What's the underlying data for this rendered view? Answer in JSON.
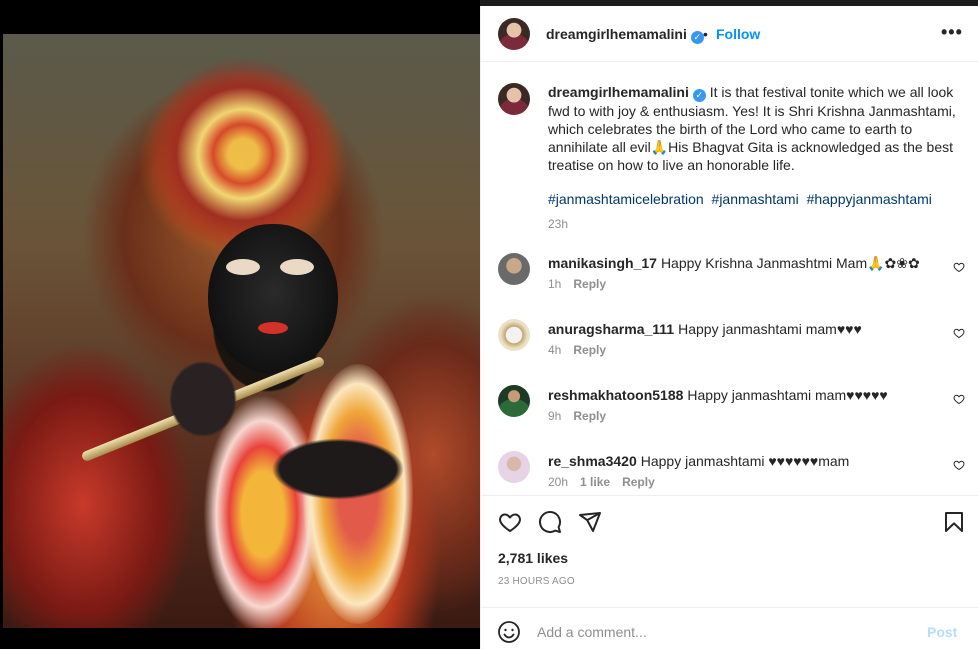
{
  "colors": {
    "accent": "#0095f6",
    "verified": "#3897f0",
    "muted": "#8e8e8e",
    "hashtag": "#00376b",
    "post_disabled": "#b2dffc"
  },
  "header": {
    "username": "dreamgirlhemamalini",
    "verified_icon": "verified-badge-icon",
    "separator": "•",
    "follow_label": "Follow",
    "more_label": "•••"
  },
  "caption": {
    "username": "dreamgirlhemamalini",
    "text": "It is that festival tonite which we all look fwd to with joy & enthusiasm. Yes! It is Shri Krishna Janmashtami, which celebrates the birth of the Lord who came to earth to annihilate all evil🙏His Bhagvat Gita is acknowledged as the best treatise on how to live an honorable life.",
    "hashtags": [
      "#janmashtamicelebration",
      "#janmashtami",
      "#happyjanmashtami"
    ],
    "time": "23h"
  },
  "comments": [
    {
      "username": "manikasingh_17",
      "text": "Happy Krishna Janmashtmi Mam🙏✿❀✿",
      "time": "1h",
      "likes": "",
      "reply": "Reply"
    },
    {
      "username": "anuragsharma_111",
      "text": "Happy janmashtami mam♥♥♥",
      "time": "4h",
      "likes": "",
      "reply": "Reply"
    },
    {
      "username": "reshmakhatoon5188",
      "text": "Happy janmashtami mam♥♥♥♥♥",
      "time": "9h",
      "likes": "",
      "reply": "Reply"
    },
    {
      "username": "re_shma3420",
      "text": "Happy janmashtami ♥♥♥♥♥♥mam",
      "time": "20h",
      "likes": "1 like",
      "reply": "Reply"
    }
  ],
  "actions": {
    "like_icon": "heart-icon",
    "comment_icon": "comment-icon",
    "share_icon": "share-icon",
    "save_icon": "bookmark-icon",
    "likes_count": "2,781 likes",
    "posted": "23 HOURS AGO"
  },
  "add_comment": {
    "emoji_icon": "emoji-icon",
    "placeholder": "Add a comment...",
    "post_label": "Post"
  }
}
